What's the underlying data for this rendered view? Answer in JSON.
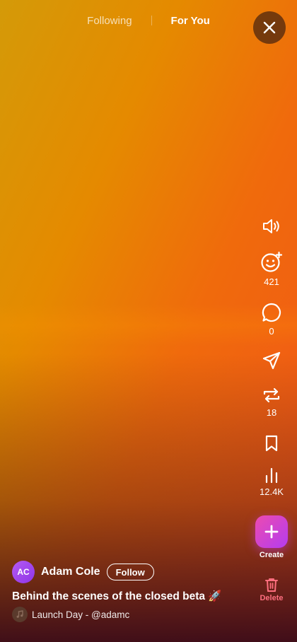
{
  "tabs": {
    "following": "Following",
    "for_you": "For You",
    "active": "for_you"
  },
  "actions": {
    "sound": {
      "icon": "speaker-icon"
    },
    "react": {
      "icon": "add-reaction-icon",
      "count": "421"
    },
    "comment": {
      "icon": "comment-icon",
      "count": "0"
    },
    "share": {
      "icon": "send-icon"
    },
    "repost": {
      "icon": "repost-icon",
      "count": "18"
    },
    "save": {
      "icon": "bookmark-icon"
    },
    "views": {
      "icon": "bar-chart-icon",
      "count": "12.4K"
    },
    "create": {
      "icon": "plus-icon",
      "label": "Create"
    },
    "delete": {
      "icon": "trash-icon",
      "label": "Delete"
    }
  },
  "author": {
    "initials": "AC",
    "name": "Adam Cole",
    "follow_label": "Follow"
  },
  "caption": "Behind the scenes of the closed beta 🚀",
  "sound": {
    "text": "Launch Day - @adamc"
  },
  "colors": {
    "create_gradient_start": "#ec4bb0",
    "create_gradient_end": "#b43cf0",
    "avatar": "#a449ee",
    "delete": "#ff6f7f"
  }
}
